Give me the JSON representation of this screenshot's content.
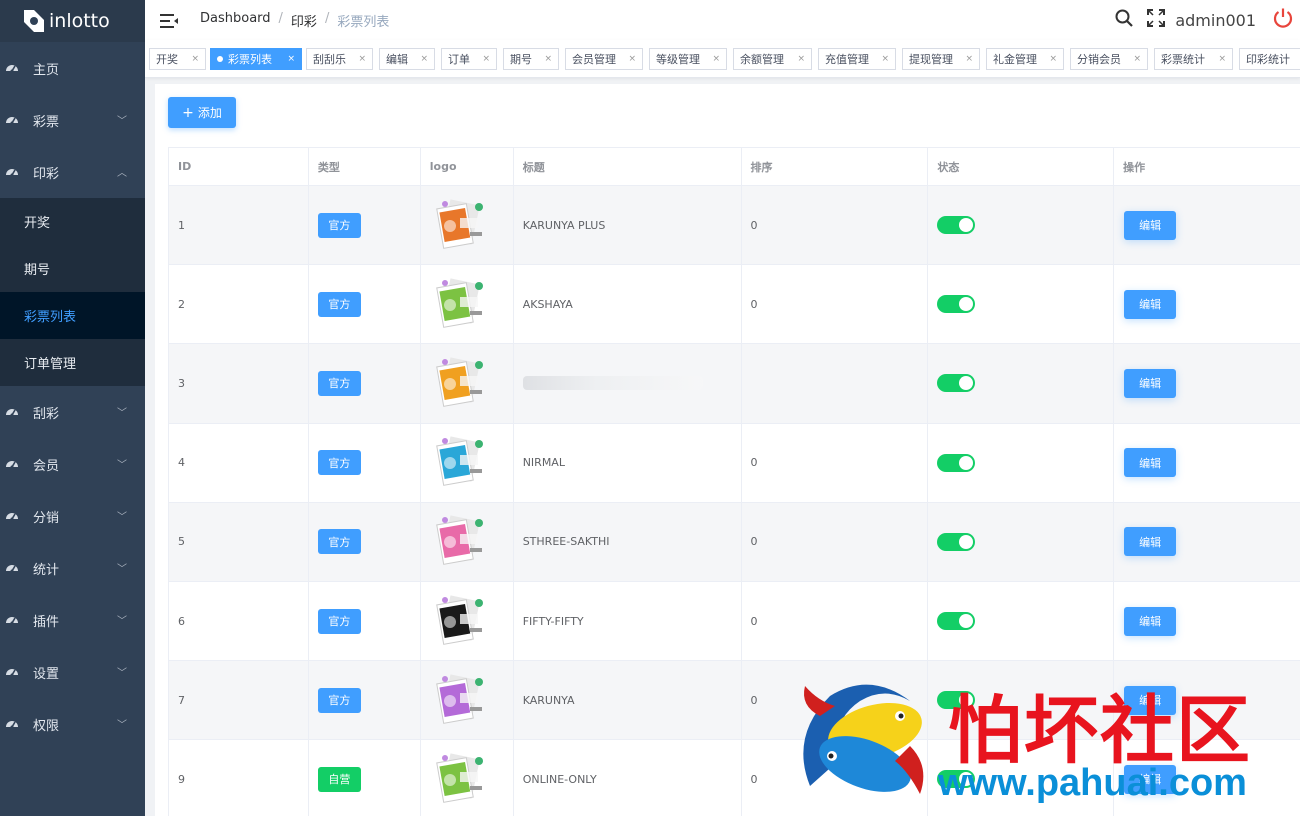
{
  "brand": {
    "name": "inlotto"
  },
  "sidebar": {
    "items": [
      {
        "label": "主页",
        "icon": "dashboard-icon",
        "expandable": false
      },
      {
        "label": "彩票",
        "icon": "dashboard-icon",
        "expandable": true
      },
      {
        "label": "印彩",
        "icon": "dashboard-icon",
        "expandable": true,
        "expanded": true,
        "children": [
          {
            "label": "开奖",
            "active": false
          },
          {
            "label": "期号",
            "active": false
          },
          {
            "label": "彩票列表",
            "active": true
          },
          {
            "label": "订单管理",
            "active": false
          }
        ]
      },
      {
        "label": "刮彩",
        "icon": "dashboard-icon",
        "expandable": true
      },
      {
        "label": "会员",
        "icon": "dashboard-icon",
        "expandable": true
      },
      {
        "label": "分销",
        "icon": "dashboard-icon",
        "expandable": true
      },
      {
        "label": "统计",
        "icon": "dashboard-icon",
        "expandable": true
      },
      {
        "label": "插件",
        "icon": "dashboard-icon",
        "expandable": true
      },
      {
        "label": "设置",
        "icon": "dashboard-icon",
        "expandable": true
      },
      {
        "label": "权限",
        "icon": "dashboard-icon",
        "expandable": true
      }
    ]
  },
  "header": {
    "breadcrumb": [
      "Dashboard",
      "印彩",
      "彩票列表"
    ],
    "user": "admin001",
    "icons": [
      "hamburger-icon",
      "search-icon",
      "fullscreen-icon",
      "power-icon"
    ]
  },
  "tags": [
    {
      "label": "开奖",
      "active": false
    },
    {
      "label": "彩票列表",
      "active": true
    },
    {
      "label": "刮刮乐",
      "active": false
    },
    {
      "label": "编辑",
      "active": false
    },
    {
      "label": "订单",
      "active": false
    },
    {
      "label": "期号",
      "active": false
    },
    {
      "label": "会员管理",
      "active": false
    },
    {
      "label": "等级管理",
      "active": false
    },
    {
      "label": "余额管理",
      "active": false
    },
    {
      "label": "充值管理",
      "active": false
    },
    {
      "label": "提现管理",
      "active": false
    },
    {
      "label": "礼金管理",
      "active": false
    },
    {
      "label": "分销会员",
      "active": false
    },
    {
      "label": "彩票统计",
      "active": false
    },
    {
      "label": "印彩统计",
      "active": false
    }
  ],
  "toolbar": {
    "add_label": "添加"
  },
  "table": {
    "columns": [
      "ID",
      "类型",
      "logo",
      "标题",
      "排序",
      "状态",
      "操作"
    ],
    "rows": [
      {
        "id": "1",
        "type": "官方",
        "type_kind": "official",
        "logo_color": "#e8772a",
        "title": "KARUNYA PLUS",
        "sort": "0",
        "enabled": true,
        "action": "编辑"
      },
      {
        "id": "2",
        "type": "官方",
        "type_kind": "official",
        "logo_color": "#7cc242",
        "title": "AKSHAYA",
        "sort": "0",
        "enabled": true,
        "action": "编辑"
      },
      {
        "id": "3",
        "type": "官方",
        "type_kind": "official",
        "logo_color": "#f0a020",
        "title": "",
        "sort": "",
        "enabled": true,
        "action": "编辑",
        "obscured": true
      },
      {
        "id": "4",
        "type": "官方",
        "type_kind": "official",
        "logo_color": "#2aa7d8",
        "title": "NIRMAL",
        "sort": "0",
        "enabled": true,
        "action": "编辑"
      },
      {
        "id": "5",
        "type": "官方",
        "type_kind": "official",
        "logo_color": "#e86aa8",
        "title": "STHREE-SAKTHI",
        "sort": "0",
        "enabled": true,
        "action": "编辑"
      },
      {
        "id": "6",
        "type": "官方",
        "type_kind": "official",
        "logo_color": "#1a1a1a",
        "title": "FIFTY-FIFTY",
        "sort": "0",
        "enabled": true,
        "action": "编辑"
      },
      {
        "id": "7",
        "type": "官方",
        "type_kind": "official",
        "logo_color": "#b46ad8",
        "title": "KARUNYA",
        "sort": "0",
        "enabled": true,
        "action": "编辑"
      },
      {
        "id": "9",
        "type": "自营",
        "type_kind": "self",
        "logo_color": "#7cc242",
        "title": "ONLINE-ONLY",
        "sort": "0",
        "enabled": true,
        "action": "编辑"
      }
    ]
  },
  "watermark": {
    "text": "怕坏社区",
    "url": "www.pahuai.com"
  },
  "colors": {
    "sidebar_bg": "#304156",
    "submenu_bg": "#1f2d3d",
    "active_sub_bg": "#001528",
    "primary": "#409eff",
    "success": "#13ce66"
  }
}
